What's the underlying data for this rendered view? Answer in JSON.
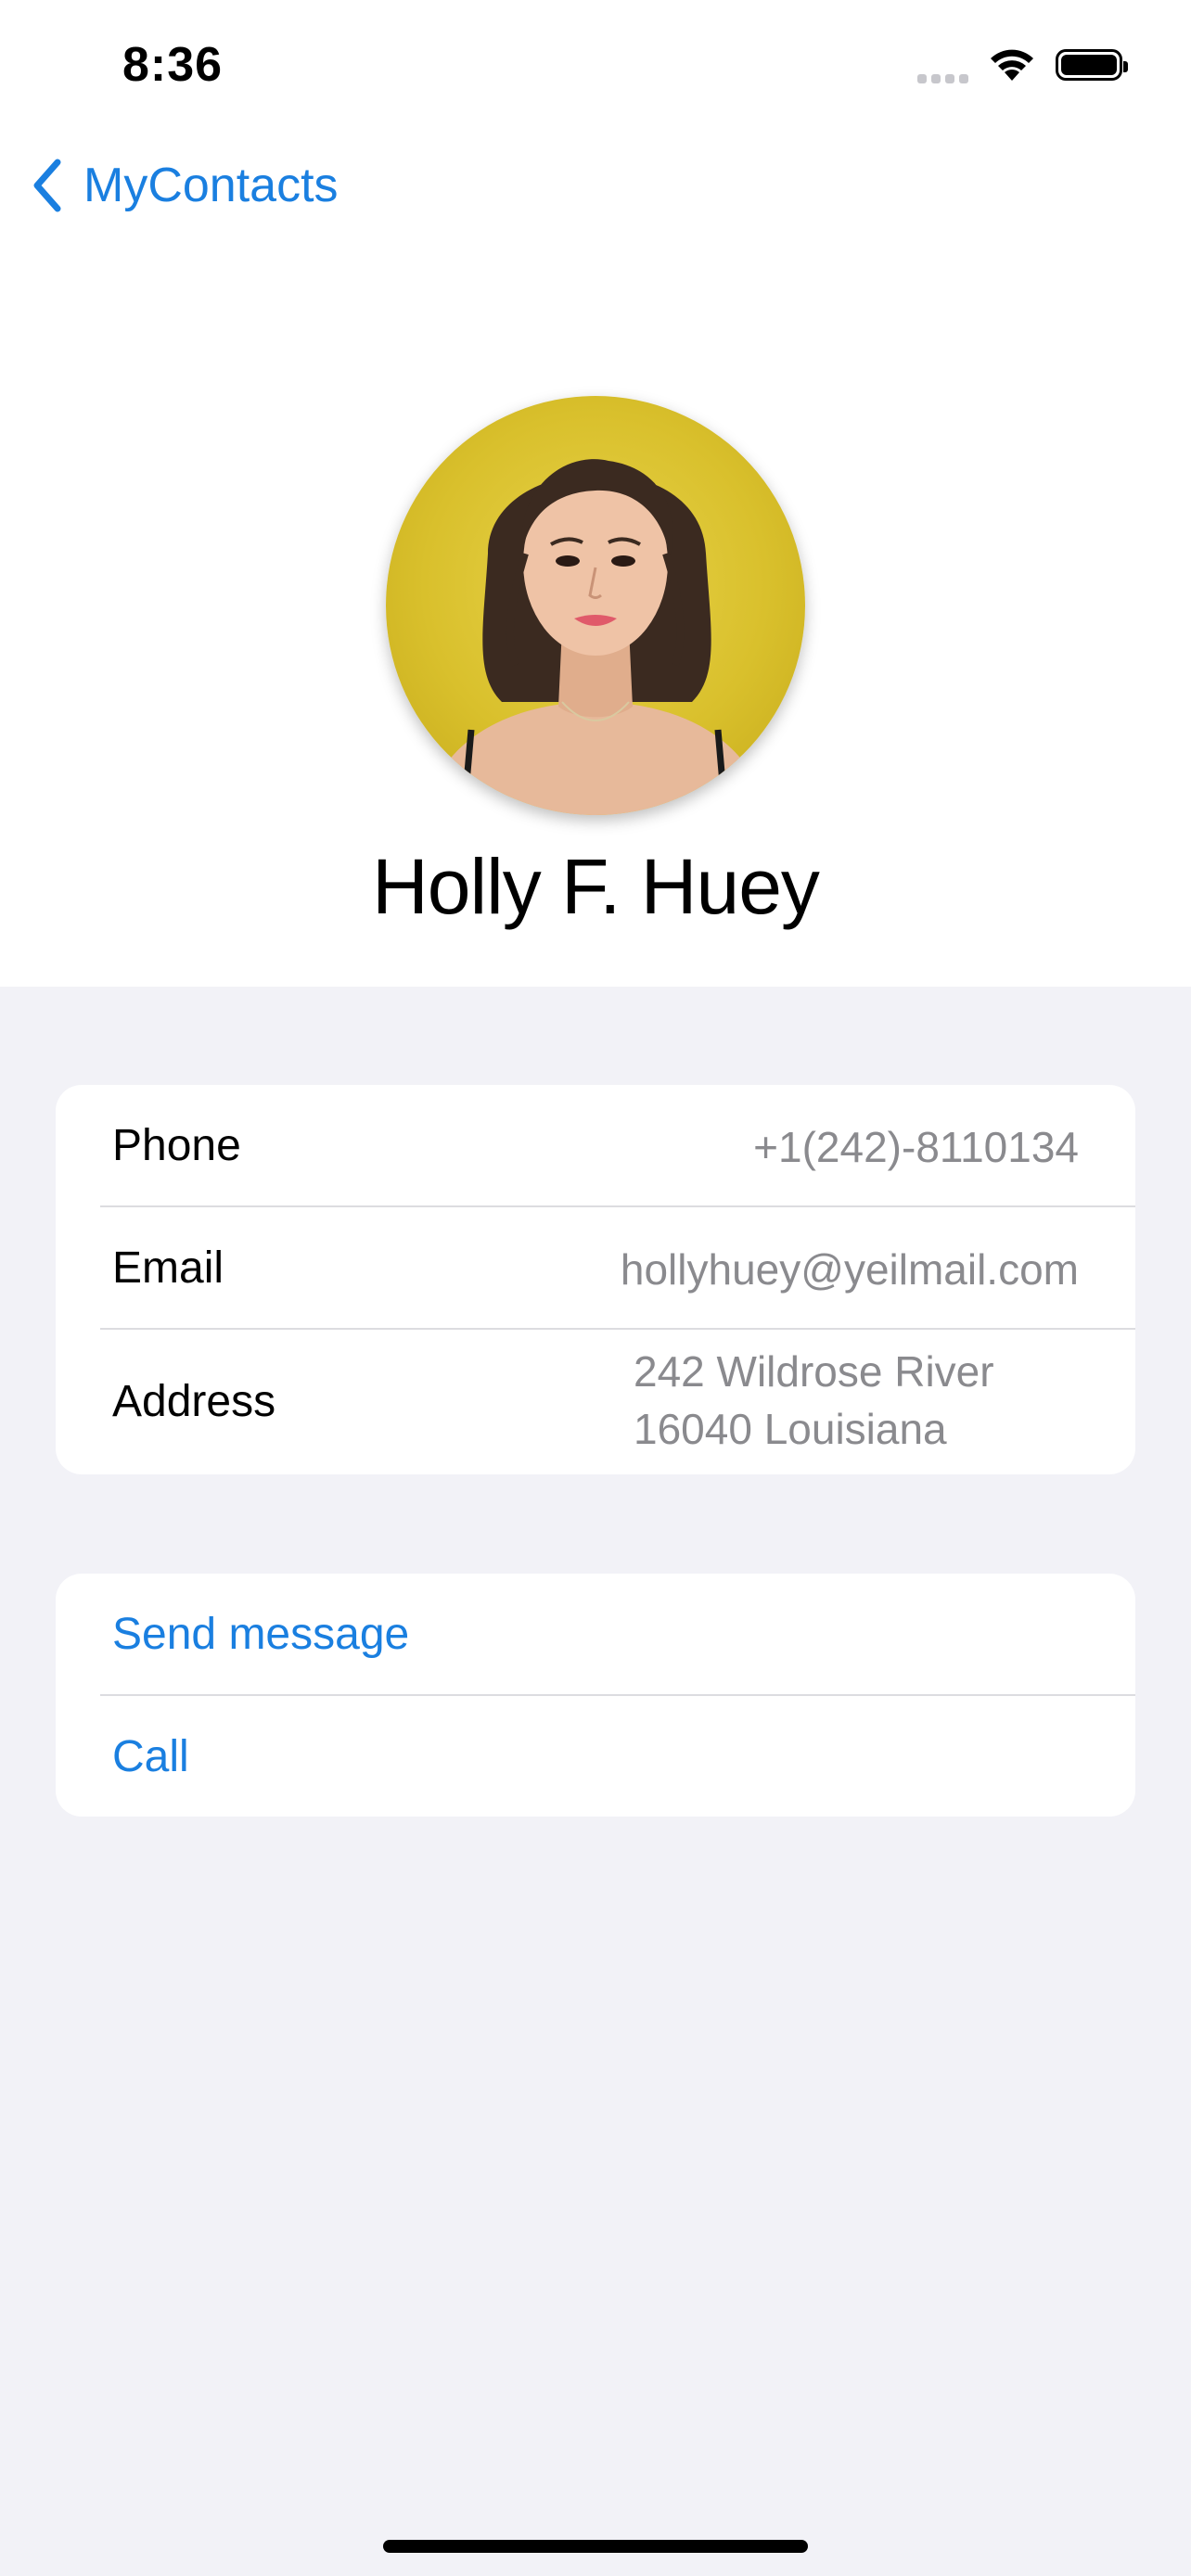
{
  "status_bar": {
    "time": "8:36",
    "signal_icon": "signal-dots-icon",
    "wifi_icon": "wifi-icon",
    "battery_icon": "battery-icon",
    "battery_level": 1.0
  },
  "navigation": {
    "back_icon": "chevron-left-icon",
    "back_label": "MyContacts"
  },
  "contact": {
    "name": "Holly F. Huey",
    "photo": "portrait photo on yellow background"
  },
  "details": {
    "phone": {
      "label": "Phone",
      "value": "+1(242)-8110134"
    },
    "email": {
      "label": "Email",
      "value": "hollyhuey@yeilmail.com"
    },
    "address": {
      "label": "Address",
      "line1": "242 Wildrose River",
      "line2": "16040 Louisiana"
    }
  },
  "actions": {
    "send_message": "Send message",
    "call": "Call"
  },
  "colors": {
    "accent": "#1a7fe0",
    "background": "#f2f2f7",
    "card": "#ffffff",
    "secondary_text": "#8a8a8e"
  }
}
